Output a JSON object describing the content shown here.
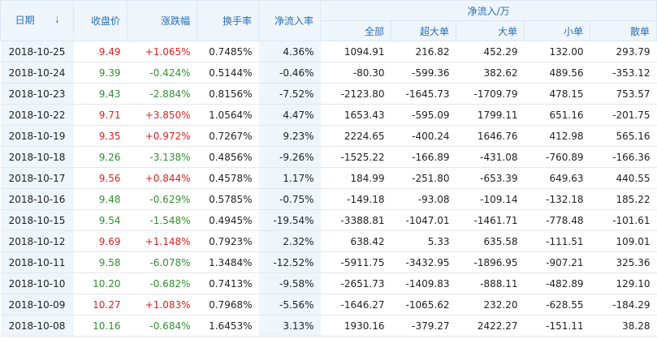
{
  "headers": {
    "date": "日期",
    "close": "收盘价",
    "change": "涨跌幅",
    "turnover": "换手率",
    "net_inflow_ratio": "净流入率",
    "net_inflow_group": "净流入/万",
    "all": "全部",
    "super_large": "超大单",
    "large": "大单",
    "small": "小单",
    "retail": "散单"
  },
  "icons": {
    "sort": "sort-arrow-down-icon"
  },
  "colors": {
    "up": "#e02020",
    "down": "#2f8f2f",
    "header_text": "#2a6fb5",
    "header_bg": "#eef5fb"
  },
  "rows": [
    {
      "date": "2018-10-25",
      "close": "9.49",
      "change": "+1.065%",
      "turnover": "0.7485%",
      "ratio": "4.36%",
      "all": "1094.91",
      "super": "216.82",
      "large": "452.29",
      "small": "132.00",
      "retail": "293.79",
      "dir": "up"
    },
    {
      "date": "2018-10-24",
      "close": "9.39",
      "change": "-0.424%",
      "turnover": "0.5144%",
      "ratio": "-0.46%",
      "all": "-80.30",
      "super": "-599.36",
      "large": "382.62",
      "small": "489.56",
      "retail": "-353.12",
      "dir": "down"
    },
    {
      "date": "2018-10-23",
      "close": "9.43",
      "change": "-2.884%",
      "turnover": "0.8156%",
      "ratio": "-7.52%",
      "all": "-2123.80",
      "super": "-1645.73",
      "large": "-1709.79",
      "small": "478.15",
      "retail": "753.57",
      "dir": "down"
    },
    {
      "date": "2018-10-22",
      "close": "9.71",
      "change": "+3.850%",
      "turnover": "1.0564%",
      "ratio": "4.47%",
      "all": "1653.43",
      "super": "-595.09",
      "large": "1799.11",
      "small": "651.16",
      "retail": "-201.75",
      "dir": "up"
    },
    {
      "date": "2018-10-19",
      "close": "9.35",
      "change": "+0.972%",
      "turnover": "0.7267%",
      "ratio": "9.23%",
      "all": "2224.65",
      "super": "-400.24",
      "large": "1646.76",
      "small": "412.98",
      "retail": "565.16",
      "dir": "up"
    },
    {
      "date": "2018-10-18",
      "close": "9.26",
      "change": "-3.138%",
      "turnover": "0.4856%",
      "ratio": "-9.26%",
      "all": "-1525.22",
      "super": "-166.89",
      "large": "-431.08",
      "small": "-760.89",
      "retail": "-166.36",
      "dir": "down"
    },
    {
      "date": "2018-10-17",
      "close": "9.56",
      "change": "+0.844%",
      "turnover": "0.4578%",
      "ratio": "1.17%",
      "all": "184.99",
      "super": "-251.80",
      "large": "-653.39",
      "small": "649.63",
      "retail": "440.55",
      "dir": "up"
    },
    {
      "date": "2018-10-16",
      "close": "9.48",
      "change": "-0.629%",
      "turnover": "0.5785%",
      "ratio": "-0.75%",
      "all": "-149.18",
      "super": "-93.08",
      "large": "-109.14",
      "small": "-132.18",
      "retail": "185.22",
      "dir": "down"
    },
    {
      "date": "2018-10-15",
      "close": "9.54",
      "change": "-1.548%",
      "turnover": "0.4945%",
      "ratio": "-19.54%",
      "all": "-3388.81",
      "super": "-1047.01",
      "large": "-1461.71",
      "small": "-778.48",
      "retail": "-101.61",
      "dir": "down"
    },
    {
      "date": "2018-10-12",
      "close": "9.69",
      "change": "+1.148%",
      "turnover": "0.7923%",
      "ratio": "2.32%",
      "all": "638.42",
      "super": "5.33",
      "large": "635.58",
      "small": "-111.51",
      "retail": "109.01",
      "dir": "up"
    },
    {
      "date": "2018-10-11",
      "close": "9.58",
      "change": "-6.078%",
      "turnover": "1.3484%",
      "ratio": "-12.52%",
      "all": "-5911.75",
      "super": "-3432.95",
      "large": "-1896.95",
      "small": "-907.21",
      "retail": "325.36",
      "dir": "down"
    },
    {
      "date": "2018-10-10",
      "close": "10.20",
      "change": "-0.682%",
      "turnover": "0.7413%",
      "ratio": "-9.58%",
      "all": "-2651.73",
      "super": "-1409.83",
      "large": "-888.11",
      "small": "-482.89",
      "retail": "129.10",
      "dir": "down"
    },
    {
      "date": "2018-10-09",
      "close": "10.27",
      "change": "+1.083%",
      "turnover": "0.7968%",
      "ratio": "-5.56%",
      "all": "-1646.27",
      "super": "-1065.62",
      "large": "232.20",
      "small": "-628.55",
      "retail": "-184.29",
      "dir": "up"
    },
    {
      "date": "2018-10-08",
      "close": "10.16",
      "change": "-0.684%",
      "turnover": "1.6453%",
      "ratio": "3.13%",
      "all": "1930.16",
      "super": "-379.27",
      "large": "2422.27",
      "small": "-151.11",
      "retail": "38.28",
      "dir": "down"
    }
  ]
}
